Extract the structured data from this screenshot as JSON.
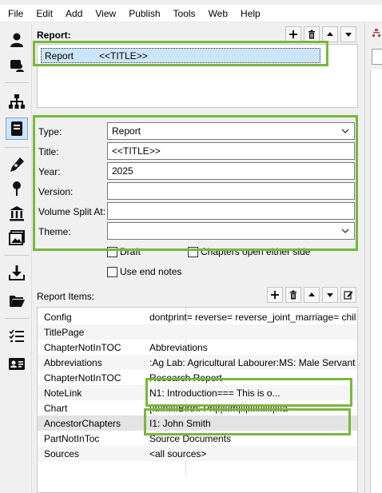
{
  "menu": [
    "File",
    "Edit",
    "Add",
    "View",
    "Publish",
    "Tools",
    "Web",
    "Help"
  ],
  "toolbar_icons": [
    "person-icon",
    "person-card-icon",
    "tree-icon",
    "book-icon",
    "pen-icon",
    "pin-icon",
    "bank-icon",
    "picture-icon",
    "download-icon",
    "folder-icon",
    "checklist-icon",
    "id-card-icon"
  ],
  "report": {
    "label": "Report:",
    "row": {
      "type": "Report",
      "title": "<<TITLE>>"
    },
    "buttons": [
      "add-icon",
      "delete-icon",
      "up-icon",
      "down-icon"
    ]
  },
  "form": {
    "type_label": "Type:",
    "type_value": "Report",
    "title_label": "Title:",
    "title_value": "<<TITLE>>",
    "year_label": "Year:",
    "year_value": "2025",
    "version_label": "Version:",
    "version_value": "",
    "volume_label": "Volume Split At:",
    "volume_value": "",
    "theme_label": "Theme:",
    "theme_value": "",
    "draft_label": "Draft",
    "chapters_label": "Chapters open either side",
    "endnotes_label": "Use end notes"
  },
  "items": {
    "label": "Report Items:",
    "rows": [
      {
        "key": "Config",
        "value": "dontprint= reverse= reverse_joint_marriage= chil"
      },
      {
        "key": "TitlePage",
        "value": ""
      },
      {
        "key": "ChapterNotInTOC",
        "value": "Abbreviations"
      },
      {
        "key": "Abbreviations",
        "value": ":Ag Lab: Agricultural Labourer:MS: Male Servant"
      },
      {
        "key": "ChapterNotInTOC",
        "value": "Research Report"
      },
      {
        "key": "NoteLink",
        "value": "N1: Introduction=== This is o..."
      },
      {
        "key": "Chart",
        "value": "[!t!!n!l!!Birth: Pri|f|l!!m|l!|l!!l!!l!l!|l!!a"
      },
      {
        "key": "AncestorChapters",
        "value": "I1: John Smith"
      },
      {
        "key": "PartNotInToc",
        "value": "Source Documents"
      },
      {
        "key": "Sources",
        "value": "<all sources>"
      }
    ]
  },
  "colors": {
    "highlight": "#79b73b",
    "selection": "#cce4f7"
  }
}
